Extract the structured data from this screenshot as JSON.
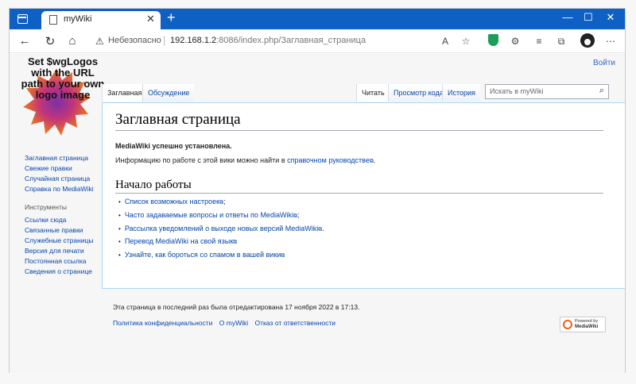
{
  "browser": {
    "tab_title": "myWiki",
    "new_tab_symbol": "+",
    "security_label": "Небезопасно",
    "url_host": "192.168.1.2",
    "url_rest": ":8086/index.php/Заглавная_страница",
    "window_controls": [
      "—",
      "☐",
      "✕"
    ]
  },
  "wiki": {
    "login": "Войти",
    "logo_text": "Set $wgLogos with the URL path to your own logo image",
    "sidebar": {
      "nav": [
        "Заглавная страница",
        "Свежие правки",
        "Случайная страница",
        "Справка по MediaWiki"
      ],
      "tools_heading": "Инструменты",
      "tools": [
        "Ссылки сюда",
        "Связанные правки",
        "Служебные страницы",
        "Версия для печати",
        "Постоянная ссылка",
        "Сведения о странице"
      ]
    },
    "tabs": {
      "page": "Заглавная",
      "talk": "Обсуждение",
      "read": "Читать",
      "source": "Просмотр кода",
      "history": "История"
    },
    "search_placeholder": "Искать в myWiki",
    "heading": "Заглавная страница",
    "installed": "MediaWiki успешно установлена.",
    "info_prefix": "Информацию по работе с этой вики можно найти в ",
    "info_link": "справочном руководстве",
    "info_suffix": ".",
    "section_title": "Начало работы",
    "links": [
      {
        "text": "Список возможных настроек",
        "suffix": ";"
      },
      {
        "text": "Часто задаваемые вопросы и ответы по MediaWiki",
        "suffix": ";"
      },
      {
        "text": "Рассылка уведомлений о выходе новых версий MediaWiki",
        "suffix": "."
      },
      {
        "text": "Перевод MediaWiki на свой язык",
        "suffix": ""
      },
      {
        "text": "Узнайте, как бороться со спамом в вашей вики",
        "suffix": ""
      }
    ],
    "footer_info": "Эта страница в последний раз была отредактирована 17 ноября 2022 в 17:13.",
    "footer_links": [
      "Политика конфиденциальности",
      "О myWiki",
      "Отказ от ответственности"
    ],
    "powered_line1": "Powered by",
    "powered_line2": "MediaWiki"
  },
  "colors": {
    "titlebar": "#0f60c4",
    "link": "#0645ad"
  }
}
